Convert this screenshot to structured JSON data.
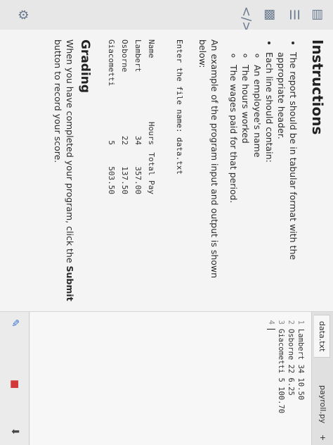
{
  "rail": {
    "icons": [
      "book-icon",
      "list-icon",
      "chart-icon",
      "code-icon"
    ]
  },
  "instructions": {
    "title": "Instructions",
    "bullet1": "The report should be in tabular format with the appropriate header.",
    "bullet2": "Each line should contain:",
    "sub1": "An employee's name",
    "sub2": "The hours worked",
    "sub3": "The wages paid for that period.",
    "example_intro": "An example of the program input and output is shown below:",
    "prompt": "Enter the file name: data.txt",
    "table": {
      "headers": [
        "Name",
        "Hours",
        "Total Pay"
      ],
      "rows": [
        [
          "Lambert",
          "34",
          "357.00"
        ],
        [
          "Osborne",
          "22",
          "137.50"
        ],
        [
          "Giacometti",
          "5",
          "503.50"
        ]
      ]
    },
    "grading_title": "Grading",
    "grading_text_1": "When you have completed your program, click the ",
    "grading_submit": "Submit",
    "grading_text_2": " button to record your score."
  },
  "editor": {
    "tabs": [
      "data.txt",
      "payroll.py",
      "+"
    ],
    "lines": [
      {
        "num": "1",
        "text": "Lambert 34 10.50"
      },
      {
        "num": "2",
        "text": "Osborne 22 6.25"
      },
      {
        "num": "3",
        "text": "Giacometti 5 100.70"
      },
      {
        "num": "4",
        "text": ""
      }
    ]
  },
  "bottombar": {
    "icons": [
      "pencil-icon",
      "trash-icon",
      "download-icon"
    ]
  }
}
